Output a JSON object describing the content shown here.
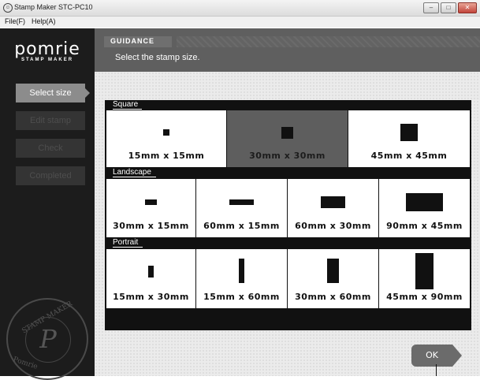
{
  "window": {
    "title": "Stamp Maker STC-PC10",
    "icon": "stamp-app-icon",
    "controls": [
      "minimize",
      "maximize",
      "close"
    ]
  },
  "menu": {
    "file": "File(F)",
    "help": "Help(A)"
  },
  "sidebar": {
    "logo": {
      "main": "pomrie",
      "sub": "STAMP MAKER"
    },
    "nav": [
      {
        "label": "Select size",
        "state": "active"
      },
      {
        "label": "Edit stamp",
        "state": "disabled"
      },
      {
        "label": "Check",
        "state": "disabled"
      },
      {
        "label": "Completed",
        "state": "disabled"
      }
    ],
    "seal": {
      "letter": "P",
      "top_text": "STAMP MAKER",
      "bottom_text": "Pomrie"
    }
  },
  "guidance": {
    "label": "GUIDANCE",
    "text": "Select the stamp size."
  },
  "sections": {
    "square": {
      "title": "Square",
      "options": [
        {
          "label": "15mm x 15mm",
          "selected": false
        },
        {
          "label": "30mm x 30mm",
          "selected": true
        },
        {
          "label": "45mm x 45mm",
          "selected": false
        }
      ]
    },
    "landscape": {
      "title": "Landscape",
      "options": [
        {
          "label": "30mm x 15mm"
        },
        {
          "label": "60mm x 15mm"
        },
        {
          "label": "60mm x 30mm"
        },
        {
          "label": "90mm x 45mm"
        }
      ]
    },
    "portrait": {
      "title": "Portrait",
      "options": [
        {
          "label": "15mm x 30mm"
        },
        {
          "label": "15mm x 60mm"
        },
        {
          "label": "30mm x 60mm"
        },
        {
          "label": "45mm x 90mm"
        }
      ]
    }
  },
  "ok_button": {
    "label": "OK"
  },
  "colors": {
    "sidebar": "#1c1c1c",
    "accent": "#8c8c8c",
    "selected": "#5e5e5e"
  }
}
